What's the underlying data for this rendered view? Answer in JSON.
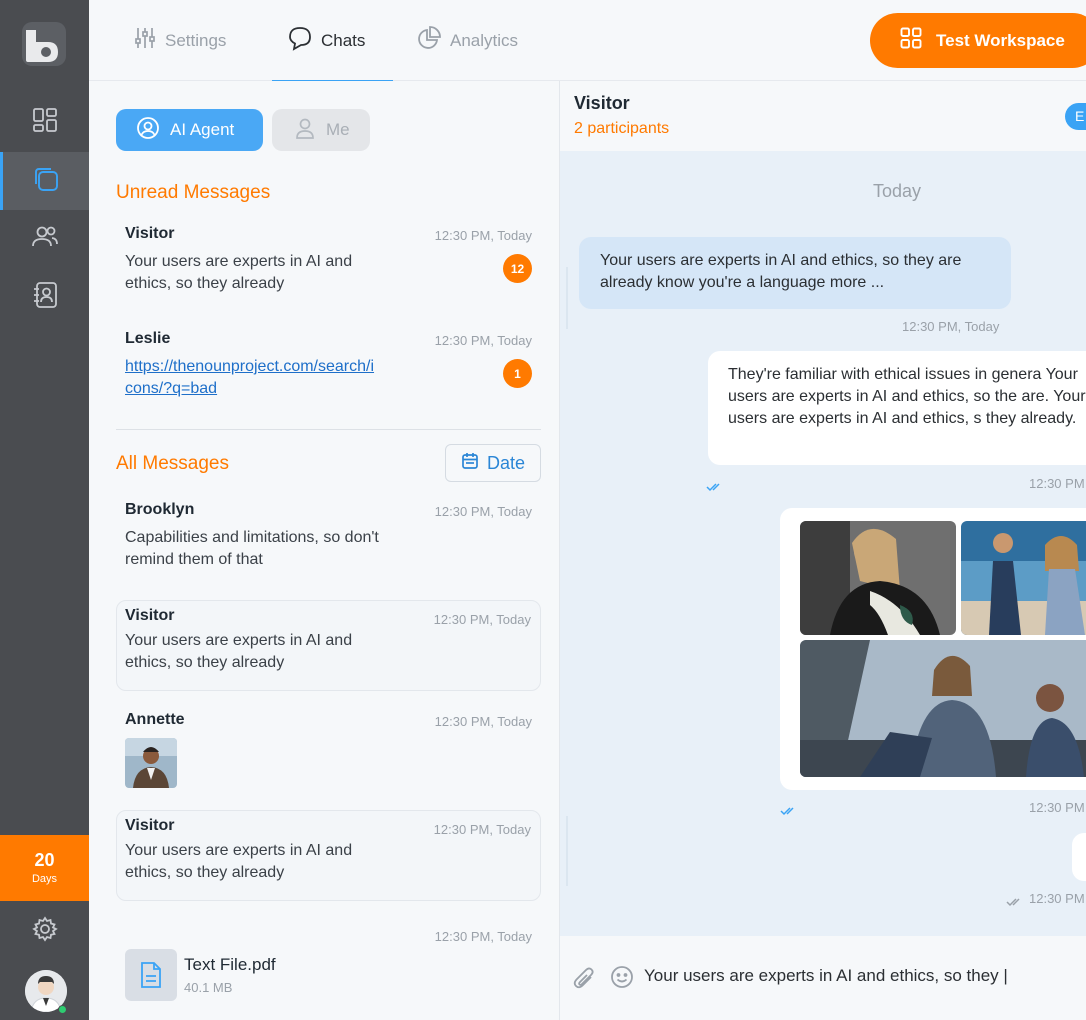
{
  "rail": {
    "trial_days": "20",
    "trial_label": "Days"
  },
  "topbar": {
    "tabs": [
      {
        "label": "Settings",
        "icon": "sliders-icon"
      },
      {
        "label": "Chats",
        "icon": "chat-bubble-icon"
      },
      {
        "label": "Analytics",
        "icon": "pie-chart-icon"
      }
    ],
    "active_tab": "Chats",
    "workspace_label": "Test Workspace"
  },
  "list": {
    "segments": [
      {
        "label": "AI Agent",
        "icon": "user-circle-icon",
        "selected": true
      },
      {
        "label": "Me",
        "icon": "user-icon",
        "selected": false
      }
    ],
    "unread_title": "Unread Messages",
    "all_title": "All Messages",
    "date_filter_label": "Date",
    "unread": [
      {
        "name": "Visitor",
        "time": "12:30 PM, Today",
        "message": "Your users are experts in AI and ethics, so they already",
        "badge": "12"
      },
      {
        "name": "Leslie",
        "time": "12:30 PM, Today",
        "link": "https://thenounproject.com/search/icons/?q=bad",
        "badge": "1"
      }
    ],
    "all": [
      {
        "name": "Brooklyn",
        "time": "12:30 PM, Today",
        "message": "Capabilities and limitations, so don't remind them of that"
      },
      {
        "name": "Visitor",
        "time": "12:30 PM, Today",
        "message": "Your users are experts in AI and ethics, so they already"
      },
      {
        "name": "Annette",
        "time": "12:30 PM, Today"
      },
      {
        "name": "Visitor",
        "time": "12:30 PM, Today",
        "message": "Your users are experts in AI and ethics, so they already"
      },
      {
        "time": "12:30 PM, Today",
        "file_name": "Text File.pdf",
        "file_size": "40.1 MB"
      }
    ]
  },
  "chat": {
    "title": "Visitor",
    "participants": "2 participants",
    "pill": "E",
    "day_separator": "Today",
    "messages": [
      {
        "text": "Your users are experts in AI and ethics, so they are already know you're a language more ...",
        "time": "12:30 PM, Today"
      },
      {
        "text": "They're familiar with ethical issues in genera Your users are experts in AI and ethics, so the are. Your users are experts in AI and ethics, s they already.",
        "time": "12:30 PM"
      },
      {
        "time": "12:30 PM"
      },
      {
        "time": "12:30 PM"
      }
    ],
    "composer_value": "Your users are experts in AI and ethics, so they |"
  },
  "colors": {
    "accent_orange": "#ff7a00",
    "accent_blue": "#3aa3f5",
    "rail_bg": "#4a4c50"
  }
}
